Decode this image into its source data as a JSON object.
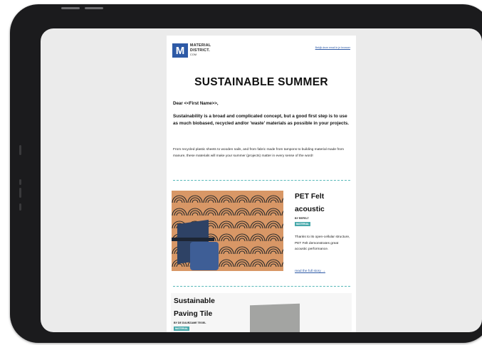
{
  "device": {
    "type": "tablet"
  },
  "email": {
    "logo_text_line1": "MATERIAL",
    "logo_text_line2": "DISTRICT.",
    "logo_text_line3": "COM",
    "browser_link": "Bekijk deze email in je browser",
    "title": "SUSTAINABLE SUMMER",
    "greeting": "Dear <<First Name>>,",
    "lead": "Sustainability is a broad and complicated concept, but a good first step is to use as much biobased, recycled and/or 'waste' materials as possible in your projects.",
    "body": "From recycled plastic sheets to wooden nails, and from fabric made from tampons to building material made from manure, these materials will make your summer (projects) matter in every sense of the word!",
    "cards": [
      {
        "title_line1": "PET Felt",
        "title_line2": "acoustic",
        "by": "BY REFELT",
        "tag": "MATERIAL",
        "description": "Thanks to its open-cellular structure, PET Felt demonstrates great acoustic performance.",
        "read_more": "read the full story →"
      },
      {
        "title_line1": "Sustainable",
        "title_line2": "Paving Tile",
        "by": "BY DE DUURZAME TEGEL",
        "tag": "MATERIAL"
      }
    ]
  },
  "colors": {
    "accent": "#2e5aa6",
    "tag": "#48a9ab",
    "divider": "#56b8b8",
    "felt": "#d89766"
  }
}
